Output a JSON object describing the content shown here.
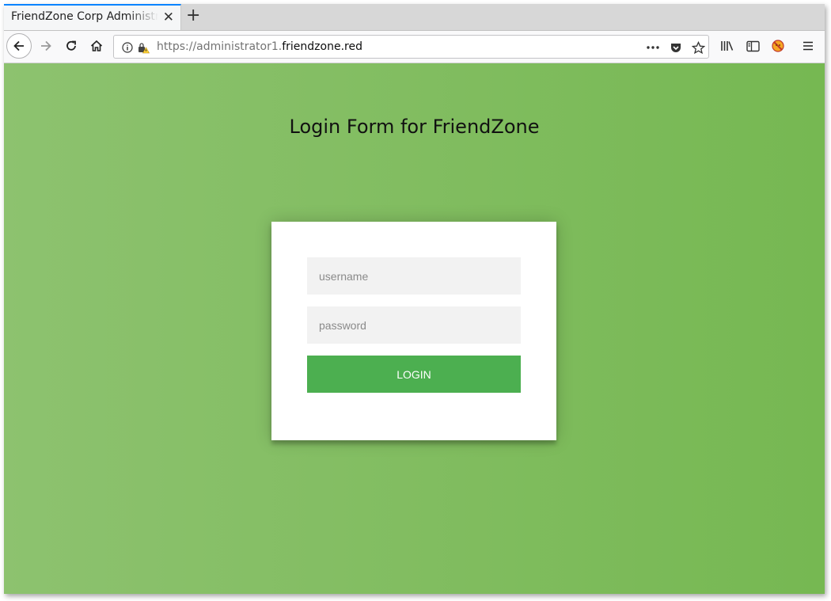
{
  "browser": {
    "tab": {
      "title": "FriendZone Corp Administrator Page",
      "close_icon": "close-icon"
    },
    "new_tab_icon": "plus-icon",
    "nav": {
      "back_icon": "arrow-left-icon",
      "forward_icon": "arrow-right-icon",
      "reload_icon": "reload-icon",
      "home_icon": "home-icon"
    },
    "url": {
      "prefix": "https://administrator1.",
      "host": "friendzone.red",
      "info_icon": "info-icon",
      "insecure_lock_icon": "insecure-lock-icon",
      "more_icon": "ellipsis-icon",
      "pocket_icon": "pocket-icon",
      "bookmark_icon": "star-icon"
    },
    "toolbar": {
      "library_icon": "library-icon",
      "sidebar_icon": "sidebar-icon",
      "extension_icon": "extension-icon",
      "menu_icon": "hamburger-menu-icon"
    }
  },
  "page": {
    "title": "Login Form for FriendZone",
    "form": {
      "username_placeholder": "username",
      "password_placeholder": "password",
      "login_label": "login"
    },
    "colors": {
      "background_start": "#8dc26f",
      "background_end": "#76b852",
      "button": "#4caf50"
    }
  }
}
